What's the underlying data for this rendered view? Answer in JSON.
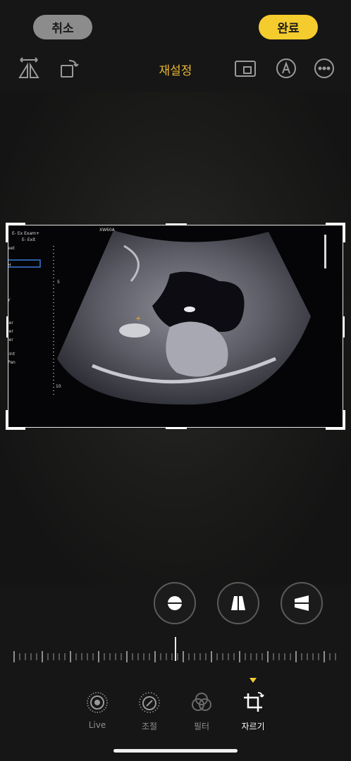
{
  "header": {
    "cancel_label": "취소",
    "done_label": "완료",
    "reset_label": "재설정"
  },
  "image": {
    "overlay_top_left": [
      "E- Ex Exam+",
      "E- Exit"
    ],
    "overlay_top_center": "XW60A",
    "overlay_left_labels": [
      "eet",
      "H",
      "Y",
      "ler",
      "ler",
      "ler",
      "-Int",
      "Pan"
    ],
    "depth_marks": [
      "5",
      "10"
    ]
  },
  "tabs": [
    {
      "label": "Live",
      "icon": "live-photo-icon"
    },
    {
      "label": "조절",
      "icon": "adjust-dial-icon"
    },
    {
      "label": "필터",
      "icon": "filters-icon"
    },
    {
      "label": "자르기",
      "icon": "crop-rotate-icon"
    }
  ],
  "colors": {
    "accent": "#f5cc2e",
    "reset_text": "#e8b732",
    "background": "#161616"
  }
}
